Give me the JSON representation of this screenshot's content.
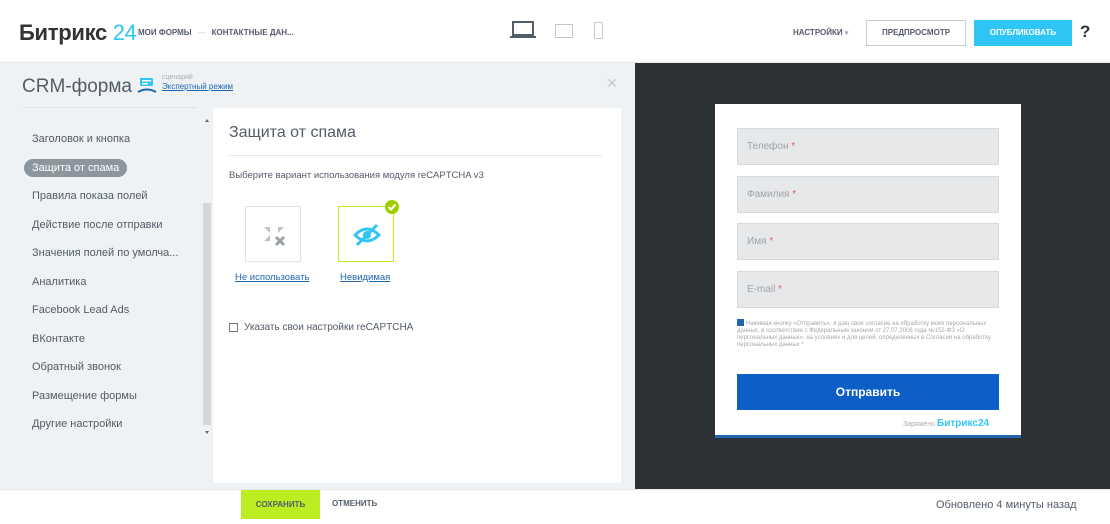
{
  "header": {
    "logo_text": "Битрикс",
    "logo_num": "24",
    "breadcrumbs": [
      "МОИ ФОРМЫ",
      "—",
      "КОНТАКТНЫЕ ДАН..."
    ],
    "settings": "НАСТРОЙКИ",
    "preview": "ПРЕДПРОСМОТР",
    "publish": "ОПУБЛИКОВАТЬ",
    "help": "?"
  },
  "panel": {
    "title": "CRM-форма",
    "scenario_label": "сценарий",
    "mode": "Экспертный режим",
    "menu": [
      {
        "label": "Заголовок и кнопка",
        "active": false
      },
      {
        "label": "Защита от спама",
        "active": true
      },
      {
        "label": "Правила показа полей",
        "active": false
      },
      {
        "label": "Действие после отправки",
        "active": false
      },
      {
        "label": "Значения полей по умолча...",
        "active": false
      },
      {
        "label": "Аналитика",
        "active": false
      },
      {
        "label": "Facebook Lead Ads",
        "active": false
      },
      {
        "label": "ВКонтакте",
        "active": false
      },
      {
        "label": "Обратный звонок",
        "active": false
      },
      {
        "label": "Размещение формы",
        "active": false
      },
      {
        "label": "Другие настройки",
        "active": false
      }
    ]
  },
  "content": {
    "heading": "Защита от спама",
    "description": "Выберите вариант использования модуля reCAPTCHA v3",
    "option_none": "Не использовать",
    "option_invisible": "Невидимая",
    "custom_settings": "Указать свои настройки reCAPTCHA"
  },
  "preview_form": {
    "fields": [
      {
        "label": "Телефон",
        "req": "*"
      },
      {
        "label": "Фамилия",
        "req": "*"
      },
      {
        "label": "Имя",
        "req": "*"
      },
      {
        "label": "E-mail",
        "req": "*"
      }
    ],
    "consent": "Нажимая кнопку «Отправить», я даю свое согласие на обработку моих персональных данных, в соответствии с Федеральным законом от 27.07.2006 года №152-ФЗ «О персональных данных», на условиях и для целей, определенных в Согласии на обработку персональных данных *",
    "submit": "Отправить",
    "charged_by": "Заряжено",
    "brand": "Битрикс24"
  },
  "footer": {
    "save": "СОХРАНИТЬ",
    "cancel": "ОТМЕНИТЬ",
    "updated": "Обновлено 4 минуты назад"
  },
  "colors": {
    "accent": "#2fc6f6",
    "save": "#bbed21",
    "submit": "#0d5fc7",
    "preview_bg": "#2c3135"
  }
}
